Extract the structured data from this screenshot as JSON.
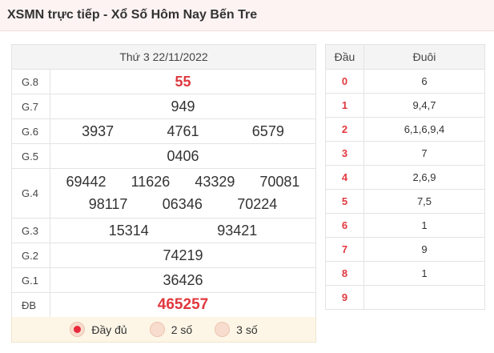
{
  "header": {
    "title": "XSMN trực tiếp - Xổ Số Hôm Nay Bến Tre"
  },
  "results": {
    "date": "Thứ 3 22/11/2022",
    "g8": {
      "label": "G.8",
      "numbers": [
        "55"
      ]
    },
    "g7": {
      "label": "G.7",
      "numbers": [
        "949"
      ]
    },
    "g6": {
      "label": "G.6",
      "numbers": [
        "3937",
        "4761",
        "6579"
      ]
    },
    "g5": {
      "label": "G.5",
      "numbers": [
        "0406"
      ]
    },
    "g4": {
      "label": "G.4",
      "numbers": [
        "69442",
        "11626",
        "43329",
        "70081",
        "98117",
        "06346",
        "70224"
      ]
    },
    "g3": {
      "label": "G.3",
      "numbers": [
        "15314",
        "93421"
      ]
    },
    "g2": {
      "label": "G.2",
      "numbers": [
        "74219"
      ]
    },
    "g1": {
      "label": "G.1",
      "numbers": [
        "36426"
      ]
    },
    "db": {
      "label": "ĐB",
      "numbers": [
        "465257"
      ]
    }
  },
  "options": [
    {
      "label": "Đầy đủ",
      "checked": true
    },
    {
      "label": "2 số",
      "checked": false
    },
    {
      "label": "3 số",
      "checked": false
    }
  ],
  "loto": {
    "head_col": "Đầu",
    "tail_col": "Đuôi",
    "rows": [
      {
        "dau": "0",
        "duoi": "6"
      },
      {
        "dau": "1",
        "duoi": "9,4,7"
      },
      {
        "dau": "2",
        "duoi": "6,1,6,9,4"
      },
      {
        "dau": "3",
        "duoi": "7"
      },
      {
        "dau": "4",
        "duoi": "2,6,9"
      },
      {
        "dau": "5",
        "duoi": "7,5"
      },
      {
        "dau": "6",
        "duoi": "1"
      },
      {
        "dau": "7",
        "duoi": "9"
      },
      {
        "dau": "8",
        "duoi": "1"
      },
      {
        "dau": "9",
        "duoi": ""
      }
    ]
  },
  "colors": {
    "accent": "#e0383e",
    "header_bg": "#fdf3f3",
    "options_bg": "#fdf6e6"
  }
}
